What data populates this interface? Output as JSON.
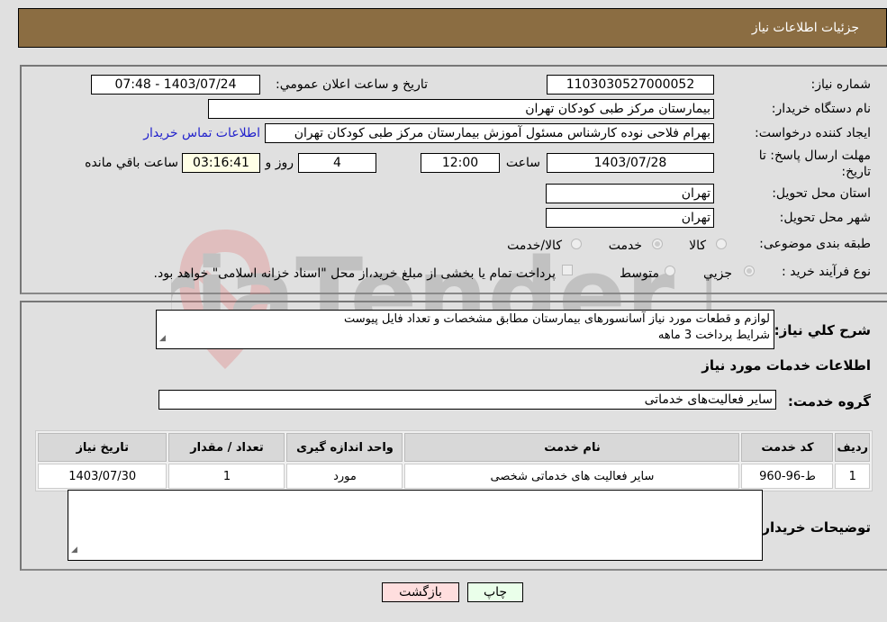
{
  "header": {
    "title": "جزئیات اطلاعات نیاز"
  },
  "fields": {
    "need_number": {
      "label": "شماره نیاز:",
      "value": "1103030527000052"
    },
    "announce_datetime": {
      "label": "تاریخ و ساعت اعلان عمومي:",
      "value": "1403/07/24 - 07:48"
    },
    "buyer_org": {
      "label": "نام دستگاه خریدار:",
      "value": "بیمارستان مرکز طبی کودکان تهران"
    },
    "creator": {
      "label": "ایجاد کننده درخواست:",
      "value": "بهرام فلاحی نوده کارشناس مسئول آموزش بیمارستان مرکز طبی کودکان تهران"
    },
    "contact_link": "اطلاعات تماس خریدار",
    "deadline": {
      "label": "مهلت ارسال پاسخ: تا تاریخ:",
      "date": "1403/07/28",
      "time_label": "ساعت",
      "time": "12:00",
      "days": "4",
      "days_label": "روز و",
      "remaining": "03:16:41",
      "remaining_label": "ساعت باقي مانده"
    },
    "province": {
      "label": "استان محل تحویل:",
      "value": "تهران"
    },
    "city": {
      "label": "شهر محل تحویل:",
      "value": "تهران"
    },
    "category": {
      "label": "طبقه بندی موضوعی:",
      "options": [
        "کالا",
        "خدمت",
        "کالا/خدمت"
      ],
      "selected": "خدمت"
    },
    "purchase_type": {
      "label": "نوع فرآیند خرید :",
      "options": [
        "جزيي",
        "متوسط"
      ],
      "selected": "جزيي",
      "checkbox_text": "پرداخت تمام یا بخشی از مبلغ خرید،از محل \"اسناد خزانه اسلامی\" خواهد بود."
    }
  },
  "description": {
    "label": "شرح کلي نياز:",
    "text_line1": "لوازم و قطعات مورد نیاز آسانسورهای بیمارستان مطابق مشخصات و تعداد فایل پیوست",
    "text_line2": "شرایط پرداخت 3 ماهه"
  },
  "services": {
    "section_title": "اطلاعات خدمات مورد نیاز",
    "group_label": "گروه خدمت:",
    "group_value": "سایر فعالیت‌های خدماتی",
    "columns": [
      "ردیف",
      "کد خدمت",
      "نام خدمت",
      "واحد اندازه گیری",
      "تعداد / مقدار",
      "تاریخ نیاز"
    ],
    "rows": [
      [
        "1",
        "ط-96-960",
        "سایر فعالیت های خدماتی شخصی",
        "مورد",
        "1",
        "1403/07/30"
      ]
    ]
  },
  "buyer_notes": {
    "label": "توضیحات خریدار:",
    "value": ""
  },
  "buttons": {
    "print": "چاپ",
    "back": "بازگشت"
  },
  "watermark": "AriaTender.neT"
}
